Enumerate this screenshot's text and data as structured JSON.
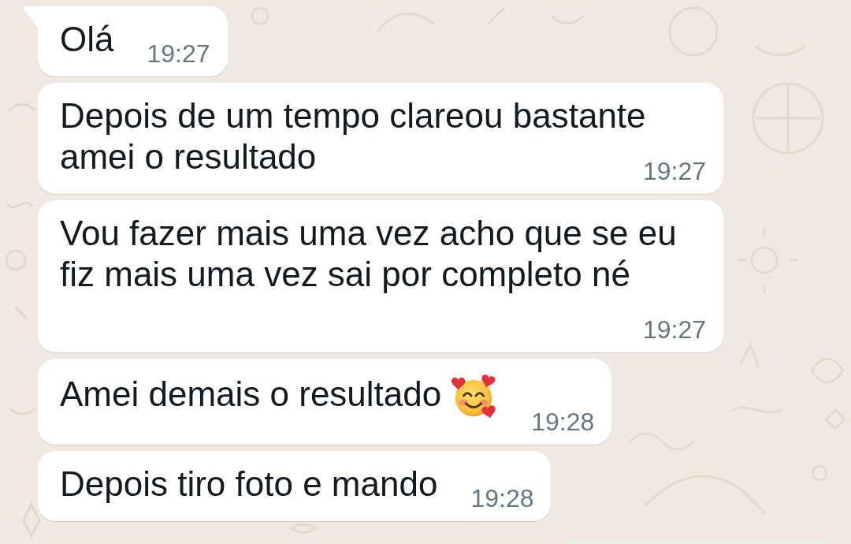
{
  "messages": [
    {
      "text": "Olá",
      "time": "19:27",
      "tail": true,
      "emoji": false
    },
    {
      "text": "Depois de um tempo clareou bastante amei o resultado",
      "time": "19:27",
      "tail": false,
      "emoji": false
    },
    {
      "text": "Vou fazer mais uma vez acho que se eu fiz mais uma vez sai por completo né",
      "time": "19:27",
      "tail": false,
      "emoji": false
    },
    {
      "text": "Amei demais o resultado",
      "time": "19:28",
      "tail": false,
      "emoji": true
    },
    {
      "text": "Depois tiro foto e mando",
      "time": "19:28",
      "tail": false,
      "emoji": false
    }
  ]
}
